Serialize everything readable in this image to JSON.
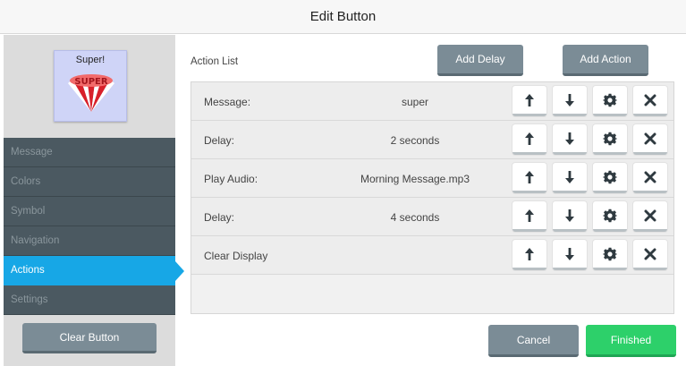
{
  "dialog": {
    "title": "Edit Button"
  },
  "sidebar": {
    "preview": {
      "label": "Super!",
      "symbol": "super-burst-image"
    },
    "items": [
      {
        "label": "Message",
        "active": false
      },
      {
        "label": "Colors",
        "active": false
      },
      {
        "label": "Symbol",
        "active": false
      },
      {
        "label": "Navigation",
        "active": false
      },
      {
        "label": "Actions",
        "active": true
      },
      {
        "label": "Settings",
        "active": false
      }
    ],
    "clear_label": "Clear Button"
  },
  "main": {
    "list_label": "Action List",
    "add_delay_label": "Add Delay",
    "add_action_label": "Add Action",
    "actions": [
      {
        "label": "Message:",
        "value": "super"
      },
      {
        "label": "Delay:",
        "value": "2 seconds"
      },
      {
        "label": "Play Audio:",
        "value": "Morning Message.mp3"
      },
      {
        "label": "Delay:",
        "value": "4 seconds"
      },
      {
        "label": "Clear Display",
        "value": ""
      }
    ],
    "row_icons": [
      "arrow-up-icon",
      "arrow-down-icon",
      "gear-icon",
      "close-icon"
    ]
  },
  "footer": {
    "cancel_label": "Cancel",
    "finished_label": "Finished"
  },
  "colors": {
    "accent": "#17a7e6",
    "sidebar_item": "#4b5961",
    "button_gray": "#7b8c96",
    "finished_green": "#2dd06a",
    "icon_dark": "#2f3a40"
  }
}
